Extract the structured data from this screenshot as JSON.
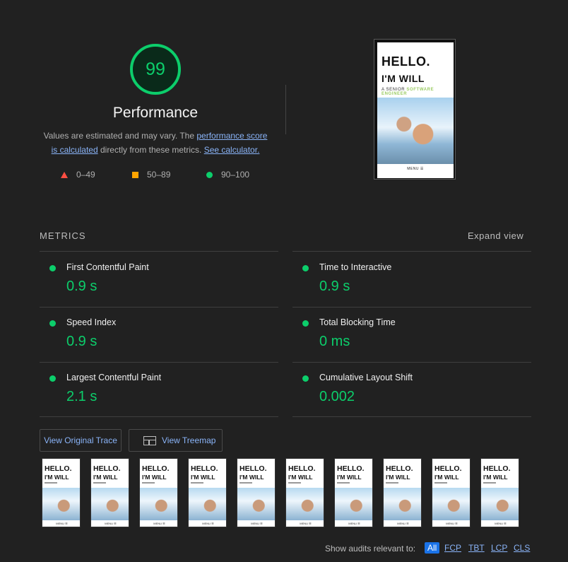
{
  "gauge": {
    "score": "99",
    "color": "#0cce6b"
  },
  "performance": {
    "title": "Performance",
    "desc_prefix": "Values are estimated and may vary. The ",
    "link_score": "performance score is calculated",
    "desc_middle": " directly from these metrics. ",
    "link_calc": "See calculator."
  },
  "legend": [
    {
      "range": "0–49",
      "shape": "triangle",
      "color": "#ff4e42"
    },
    {
      "range": "50–89",
      "shape": "square",
      "color": "#ffa400"
    },
    {
      "range": "90–100",
      "shape": "circle",
      "color": "#0cce6b"
    }
  ],
  "screenshot": {
    "line1": "HELLO.",
    "line2": "I'M WILL",
    "tagline_prefix": "A SENIOR ",
    "tagline_highlight": "SOFTWARE ENGINEER",
    "menu": "MENU ☰"
  },
  "metrics": {
    "title": "METRICS",
    "expand_label": "Expand view",
    "items": [
      {
        "label": "First Contentful Paint",
        "value": "0.9 s"
      },
      {
        "label": "Time to Interactive",
        "value": "0.9 s"
      },
      {
        "label": "Speed Index",
        "value": "0.9 s"
      },
      {
        "label": "Total Blocking Time",
        "value": "0 ms"
      },
      {
        "label": "Largest Contentful Paint",
        "value": "2.1 s"
      },
      {
        "label": "Cumulative Layout Shift",
        "value": "0.002"
      }
    ]
  },
  "buttons": {
    "trace": "View Original Trace",
    "treemap": "View Treemap"
  },
  "filmstrip": {
    "count": 10,
    "frame_line1": "HELLO.",
    "frame_line2": "I'M WILL",
    "frame_menu": "MENU ☰"
  },
  "audits": {
    "label": "Show audits relevant to:",
    "chips": [
      "All",
      "FCP",
      "TBT",
      "LCP",
      "CLS"
    ]
  }
}
